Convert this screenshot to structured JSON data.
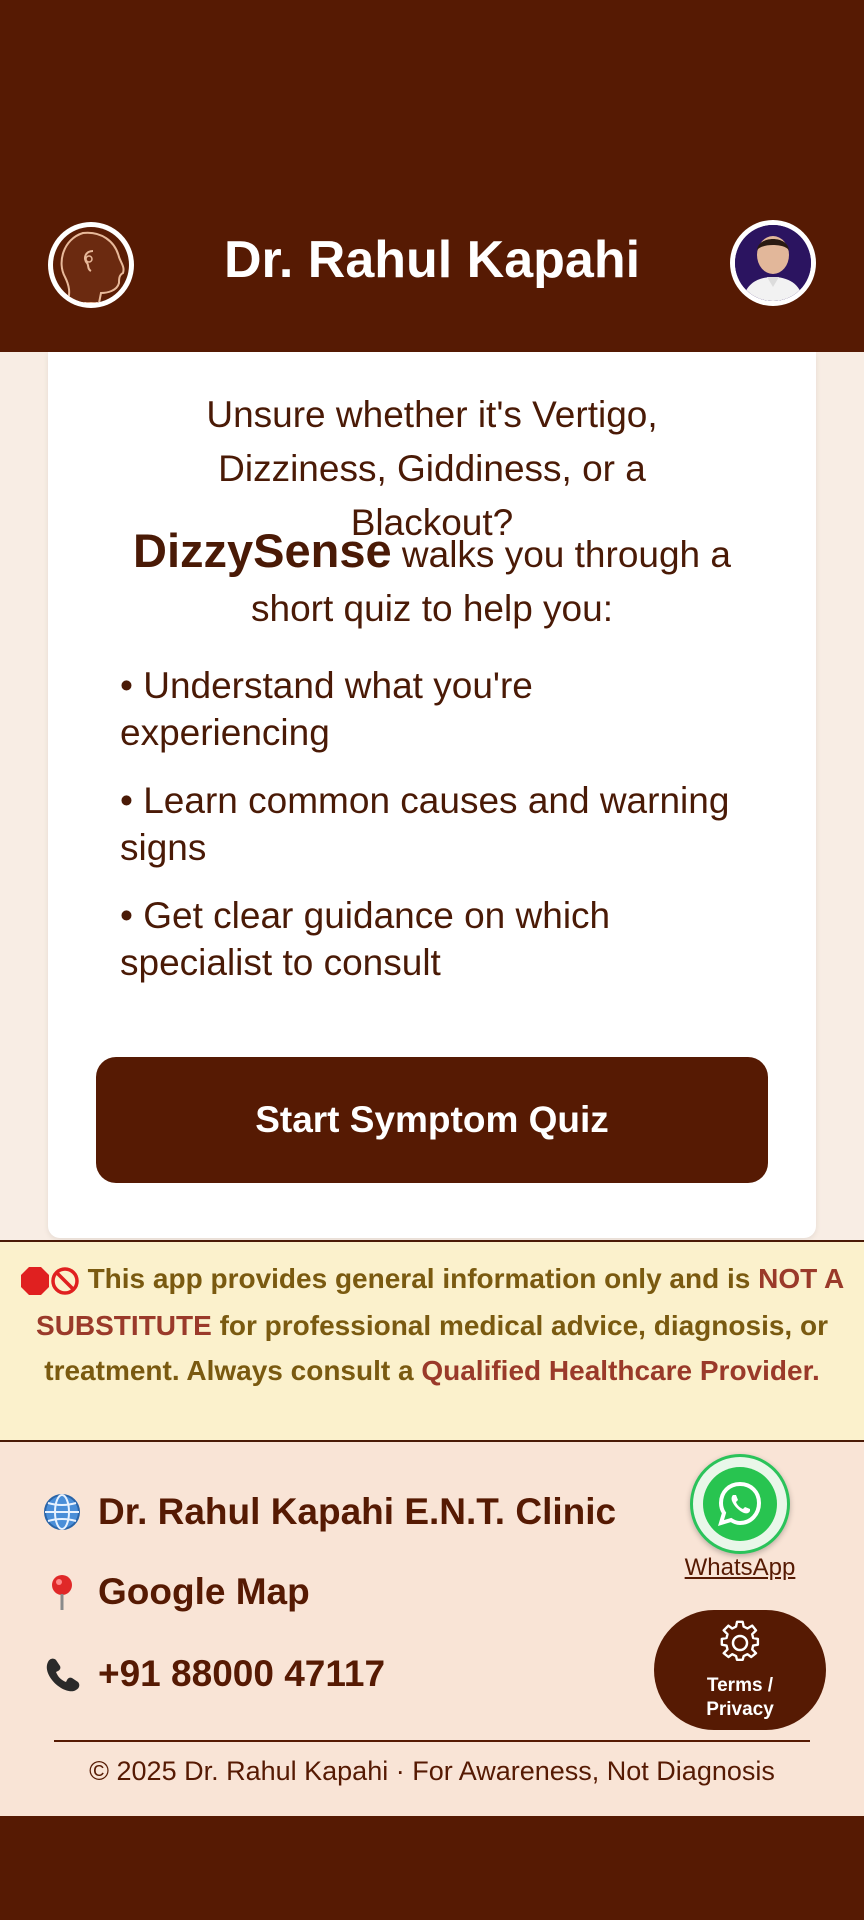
{
  "header": {
    "title": "Dr. Rahul Kapahi"
  },
  "intro": {
    "question": "Unsure whether it's Vertigo, Dizziness, Giddiness, or a Blackout?",
    "brand_name": "DizzySense",
    "brand_tail": " walks you through a short quiz to help you:",
    "bullets": [
      "• Understand what you're experiencing",
      "• Learn common causes and warning signs",
      "• Get clear guidance on which specialist to consult"
    ],
    "cta_label": "Start Symptom Quiz"
  },
  "disclaimer": {
    "part1": "This app provides general information only and is ",
    "part2": "NOT A SUBSTITUTE",
    "part3": " for professional medical advice, diagnosis, or treatment. Always consult a ",
    "part4": "Qualified Healthcare Provider",
    "part5": "."
  },
  "footer": {
    "clinic_label": "Dr. Rahul Kapahi E.N.T. Clinic",
    "map_label": "Google Map",
    "phone_label": "+91 88000 47117",
    "whatsapp_label": "WhatsApp",
    "terms_label": "Terms / Privacy",
    "copyright": "© 2025 Dr. Rahul Kapahi · For Awareness, Not Diagnosis"
  },
  "icons": {
    "logo": "ear-profile-logo",
    "avatar": "doctor-avatar",
    "clinic": "globe-icon",
    "map": "pin-icon",
    "phone": "phone-icon",
    "whatsapp": "whatsapp-icon",
    "terms": "gear-icon",
    "stop": "stop-icon",
    "prohibited": "prohibited-icon"
  },
  "colors": {
    "brand": "#561a03",
    "card": "#ffffff",
    "disclaimer_bg": "#fbf1cc",
    "footer_bg": "#f9e4d6",
    "whatsapp_green": "#28c450"
  }
}
